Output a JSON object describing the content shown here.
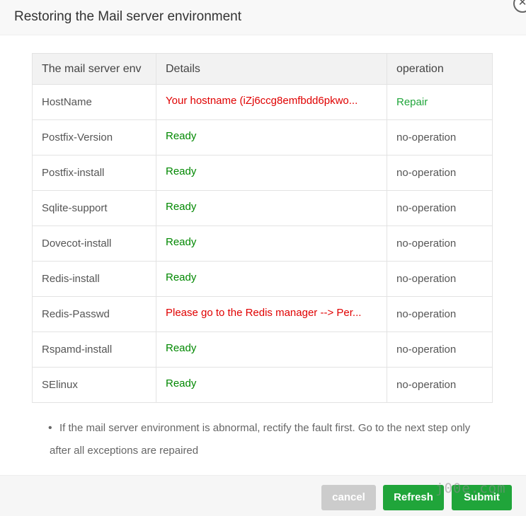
{
  "dialog": {
    "title": "Restoring the Mail server environment",
    "close_icon": "close-icon"
  },
  "table": {
    "headers": [
      "The mail server env",
      "Details",
      "operation"
    ],
    "rows": [
      {
        "env": "HostName",
        "details": "Your hostname (iZj6ccg8emfbdd6pkwo...",
        "operation": "Repair",
        "details_status": "error",
        "operation_action": true
      },
      {
        "env": "Postfix-Version",
        "details": "Ready",
        "operation": "no-operation",
        "details_status": "ok"
      },
      {
        "env": "Postfix-install",
        "details": "Ready",
        "operation": "no-operation",
        "details_status": "ok"
      },
      {
        "env": "Sqlite-support",
        "details": "Ready",
        "operation": "no-operation",
        "details_status": "ok"
      },
      {
        "env": "Dovecot-install",
        "details": "Ready",
        "operation": "no-operation",
        "details_status": "ok"
      },
      {
        "env": "Redis-install",
        "details": "Ready",
        "operation": "no-operation",
        "details_status": "ok"
      },
      {
        "env": "Redis-Passwd",
        "details": "Please go to the Redis manager --> Per...",
        "operation": "no-operation",
        "details_status": "error"
      },
      {
        "env": "Rspamd-install",
        "details": "Ready",
        "operation": "no-operation",
        "details_status": "ok"
      },
      {
        "env": "SElinux",
        "details": "Ready",
        "operation": "no-operation",
        "details_status": "ok"
      }
    ]
  },
  "note": {
    "bullet": "•",
    "text": "If the mail server environment is abnormal, rectify the fault first. Go to the next step only after all exceptions are repaired"
  },
  "footer": {
    "cancel_label": "cancel",
    "refresh_label": "Refresh",
    "submit_label": "Submit"
  },
  "watermark": "j00e.com",
  "colors": {
    "ok": "#008800",
    "error": "#e00000",
    "primary": "#20a53a",
    "disabled": "#cccccc"
  }
}
